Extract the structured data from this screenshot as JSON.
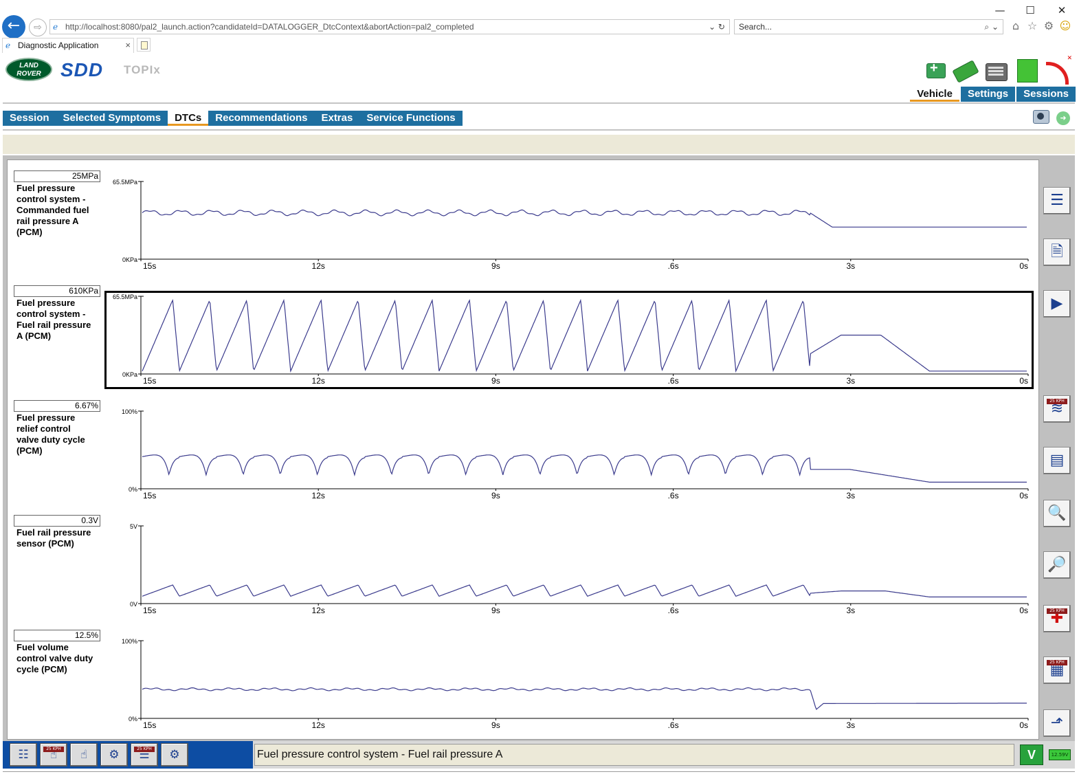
{
  "browser": {
    "url": "http://localhost:8080/pal2_launch.action?candidateId=DATALOGGER_DtcContext&abortAction=pal2_completed",
    "search_placeholder": "Search...",
    "tab_title": "Diagnostic Application",
    "tab_close": "×",
    "window_controls": {
      "minimize": "—",
      "maximize": "☐",
      "close": "✕"
    },
    "url_tools": "⌄ ↻",
    "search_tools": "⌕ ⌄",
    "toolbar_icons": [
      "home-icon",
      "star-icon",
      "gear-icon",
      "smiley-icon"
    ]
  },
  "app": {
    "brand_logo": "LAND ROVER",
    "product": "SDD",
    "module": "TOPIx",
    "top_nav": [
      "Vehicle",
      "Settings",
      "Sessions"
    ],
    "top_nav_active": "Vehicle",
    "menu": [
      "Session",
      "Selected Symptoms",
      "DTCs",
      "Recommendations",
      "Extras",
      "Service Functions"
    ],
    "menu_active": "DTCs"
  },
  "plots": [
    {
      "label": "Fuel pressure control system  -  Commanded fuel rail pressure A (PCM)",
      "label_lines": [
        "Fuel pressure",
        "control system  -",
        "Commanded fuel",
        "rail pressure A",
        "(PCM)"
      ],
      "current_value": "25MPa",
      "y_max_label": "65.5MPa",
      "y_min_label": "0KPa",
      "selected": false
    },
    {
      "label": "Fuel pressure control system  -  Fuel rail pressure A (PCM)",
      "label_lines": [
        "Fuel pressure",
        "control system  -",
        "Fuel rail pressure",
        "A (PCM)"
      ],
      "current_value": "610KPa",
      "y_max_label": "65.5MPa",
      "y_min_label": "0KPa",
      "selected": true
    },
    {
      "label": "Fuel pressure relief control valve duty cycle (PCM)",
      "label_lines": [
        "Fuel pressure",
        "relief control",
        "valve duty cycle",
        "(PCM)"
      ],
      "current_value": "6.67%",
      "y_max_label": "100%",
      "y_min_label": "0%",
      "selected": false
    },
    {
      "label": "Fuel rail pressure sensor (PCM)",
      "label_lines": [
        "Fuel rail pressure",
        "sensor (PCM)"
      ],
      "current_value": "0.3V",
      "y_max_label": "5V",
      "y_min_label": "0V",
      "selected": false
    },
    {
      "label": "Fuel volume control valve duty cycle (PCM)",
      "label_lines": [
        "Fuel volume",
        "control valve duty",
        "cycle (PCM)"
      ],
      "current_value": "12.5%",
      "y_max_label": "100%",
      "y_min_label": "0%",
      "selected": false
    }
  ],
  "time_axis_labels": [
    "15s",
    "12s",
    "9s",
    ".6s",
    "3s",
    "0s"
  ],
  "trace_color": "#3a3a8c",
  "right_toolbar": [
    {
      "name": "list-view-icon",
      "glyph": "☰",
      "badge": ""
    },
    {
      "name": "save-log-icon",
      "glyph": "🗎",
      "badge": ""
    },
    {
      "name": "play-icon",
      "glyph": "▶",
      "badge": ""
    },
    {
      "name": "speed-graph-icon",
      "glyph": "≋",
      "badge": "25 KPH"
    },
    {
      "name": "parameter-list-icon",
      "glyph": "▤",
      "badge": ""
    },
    {
      "name": "zoom-graph-icon",
      "glyph": "🔍",
      "badge": ""
    },
    {
      "name": "zoom-detail-icon",
      "glyph": "🔎",
      "badge": ""
    },
    {
      "name": "add-signal-icon",
      "glyph": "✚",
      "badge": "25 KPH"
    },
    {
      "name": "gauge-view-icon",
      "glyph": "▦",
      "badge": "25 KPH"
    },
    {
      "name": "trigger-icon",
      "glyph": "⬏",
      "badge": ""
    }
  ],
  "status_bar": {
    "message": "Fuel pressure control system  -  Fuel rail pressure A",
    "buttons": [
      {
        "name": "report-icon",
        "glyph": "☷",
        "badge": ""
      },
      {
        "name": "datalogger-select-icon",
        "glyph": "☝",
        "badge": "25 KPH"
      },
      {
        "name": "select-signals-icon",
        "glyph": "☝",
        "badge": ""
      },
      {
        "name": "network-config-icon",
        "glyph": "⚙",
        "badge": ""
      },
      {
        "name": "dashboard-icon",
        "glyph": "☰",
        "badge": "25 KPH"
      },
      {
        "name": "record-icon",
        "glyph": "⚙",
        "badge": ""
      }
    ],
    "vci_label": "V",
    "battery_label": "12.59V"
  }
}
